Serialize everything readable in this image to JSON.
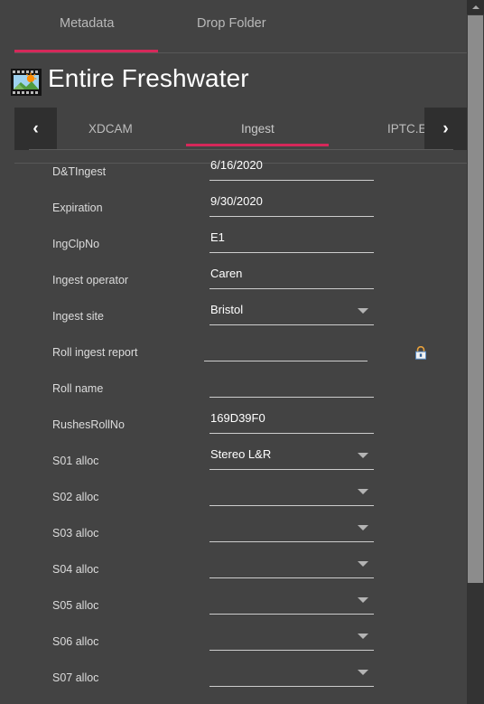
{
  "window": {
    "background": "#434343",
    "accent": "#d6285a"
  },
  "top_tabs": [
    {
      "label": "Metadata",
      "active": true
    },
    {
      "label": "Drop Folder",
      "active": false
    }
  ],
  "header": {
    "title": "Entire Freshwater",
    "icon": "image-thumbnail-icon"
  },
  "sub_tabs": {
    "prev_arrow": "‹",
    "next_arrow": "›",
    "items": [
      {
        "label": "XDCAM",
        "active": false
      },
      {
        "label": "Ingest",
        "active": true
      },
      {
        "label": "IPTC.Envelope",
        "active": false
      }
    ]
  },
  "fields": [
    {
      "label": "D&TIngest",
      "value": "6/16/2020",
      "type": "text",
      "locked": false
    },
    {
      "label": "Expiration",
      "value": "9/30/2020",
      "type": "text",
      "locked": false
    },
    {
      "label": "IngClpNo",
      "value": "E1",
      "type": "text",
      "locked": false
    },
    {
      "label": "Ingest operator",
      "value": "Caren",
      "type": "text",
      "locked": false
    },
    {
      "label": "Ingest site",
      "value": "Bristol",
      "type": "dropdown",
      "locked": false
    },
    {
      "label": "Roll ingest report",
      "value": "",
      "type": "text",
      "locked": true
    },
    {
      "label": "Roll name",
      "value": "",
      "type": "text",
      "locked": false
    },
    {
      "label": "RushesRollNo",
      "value": "169D39F0",
      "type": "text",
      "locked": false
    },
    {
      "label": "S01 alloc",
      "value": "Stereo L&R",
      "type": "dropdown",
      "locked": false
    },
    {
      "label": "S02 alloc",
      "value": "",
      "type": "dropdown",
      "locked": false
    },
    {
      "label": "S03 alloc",
      "value": "",
      "type": "dropdown",
      "locked": false
    },
    {
      "label": "S04 alloc",
      "value": "",
      "type": "dropdown",
      "locked": false
    },
    {
      "label": "S05 alloc",
      "value": "",
      "type": "dropdown",
      "locked": false
    },
    {
      "label": "S06 alloc",
      "value": "",
      "type": "dropdown",
      "locked": false
    },
    {
      "label": "S07 alloc",
      "value": "",
      "type": "dropdown",
      "locked": false
    }
  ],
  "scrollbar": {
    "up_arrow": "▲"
  }
}
